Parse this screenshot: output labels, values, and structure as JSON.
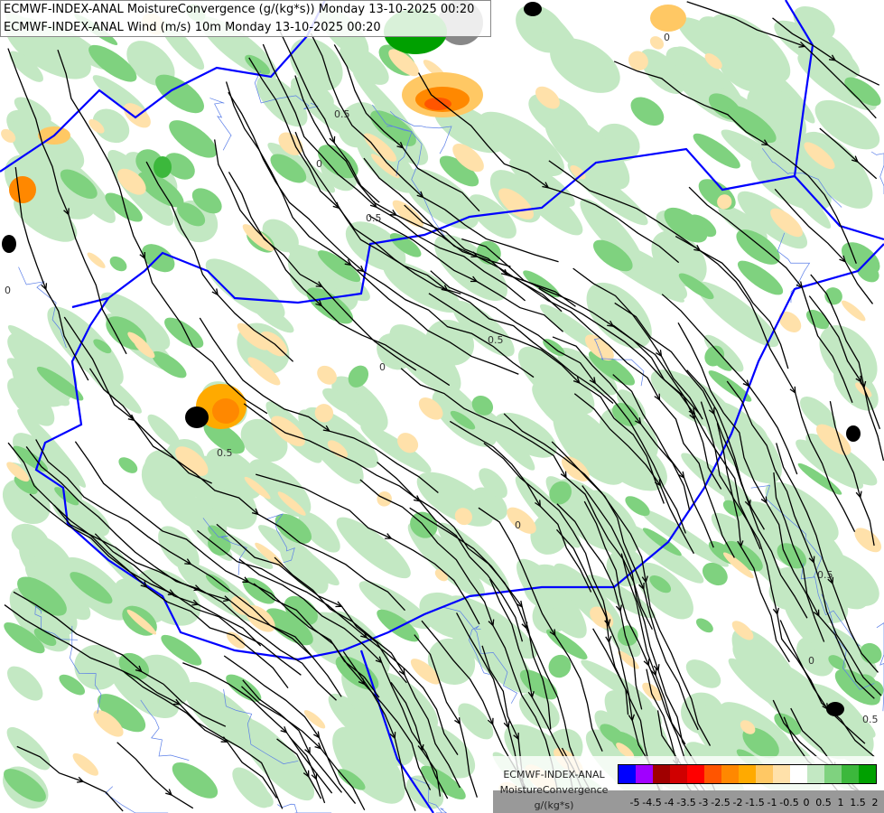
{
  "header": {
    "line1": "ECMWF-INDEX-ANAL MoistureConvergence (g/(kg*s)) Monday 13-10-2025 00:20",
    "line2": "ECMWF-INDEX-ANAL Wind (m/s) 10m Monday 13-10-2025 00:20"
  },
  "legend": {
    "model": "ECMWF-INDEX-ANAL",
    "parameter": "MoistureConvergence",
    "unit": "g/(kg*s)",
    "colors": [
      "#0000ff",
      "#a000ff",
      "#a00000",
      "#d00000",
      "#ff0000",
      "#ff5500",
      "#ff8800",
      "#ffaa00",
      "#ffc864",
      "#ffe1aa",
      "#ffffff",
      "#c3e8c3",
      "#7fd27f",
      "#3cb83c",
      "#00a000"
    ],
    "ticks": [
      "-5",
      "-4.5",
      "-4",
      "-3.5",
      "-3",
      "-2.5",
      "-2",
      "-1.5",
      "-1",
      "-0.5",
      "0",
      "0.5",
      "1",
      "1.5",
      "2"
    ]
  },
  "map": {
    "contour_labels": [
      "0",
      "0.5",
      "0",
      "0.5",
      "0",
      "0.5",
      "0",
      "0.5",
      "0",
      "0.5",
      "0",
      "0.5"
    ],
    "border_color": "#0000ff",
    "streamline_color": "#000000"
  }
}
